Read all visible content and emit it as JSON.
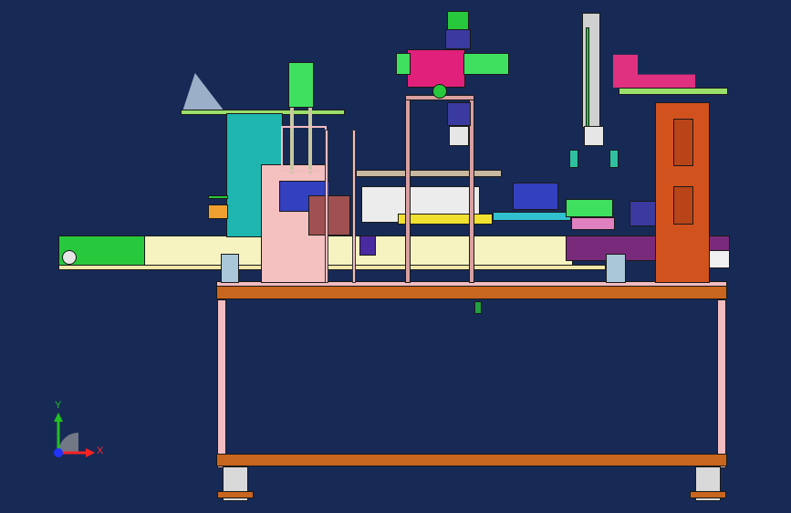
{
  "viewport": {
    "background": "#172a56",
    "render_mode": "shaded-with-edges"
  },
  "triad": {
    "x_label": "X",
    "y_label": "Y",
    "x_color": "#ff2222",
    "y_color": "#22c022",
    "z_color": "#2233ff"
  },
  "colors": {
    "frame": "#f2bcc0",
    "frame_beam": "#c8651e",
    "conveyor": "#f6f3c0",
    "conveyor_right": "#7a2a7a",
    "teal_block": "#1fb6b0",
    "green_motor": "#28d040",
    "magenta_head": "#e0207a",
    "orange_tower": "#d2521e",
    "pink_column": "#f4b8b8"
  }
}
